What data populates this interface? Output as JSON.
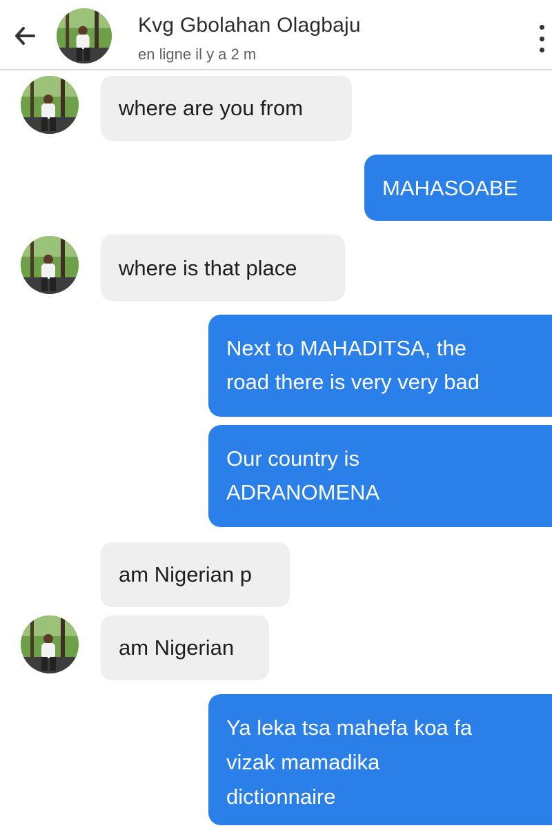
{
  "header": {
    "contact_name": "Kvg Gbolahan Olagbaju",
    "status": "en ligne il y a 2 m"
  },
  "messages": [
    {
      "direction": "incoming",
      "lines": [
        "where are you from"
      ]
    },
    {
      "direction": "outgoing",
      "lines": [
        "MAHASOABE"
      ]
    },
    {
      "direction": "incoming",
      "lines": [
        "where is that place"
      ]
    },
    {
      "direction": "outgoing",
      "lines": [
        "Next to MAHADITSA, the",
        "road there is very very bad"
      ]
    },
    {
      "direction": "outgoing",
      "lines": [
        "Our country is",
        "ADRANOMENA"
      ]
    },
    {
      "direction": "incoming",
      "lines": [
        "am Nigerian p"
      ]
    },
    {
      "direction": "incoming",
      "lines": [
        "am Nigerian"
      ]
    },
    {
      "direction": "outgoing",
      "lines": [
        "Ya leka tsa mahefa koa fa",
        "vizak mamadika",
        "dictionnaire"
      ]
    }
  ],
  "icons": {
    "back": "arrow-left-icon",
    "menu": "more-vertical-icon",
    "avatar": "contact-avatar"
  },
  "colors": {
    "incoming_bubble": "#efefef",
    "outgoing_bubble": "#2a7fe8",
    "outgoing_text": "#ffffff",
    "incoming_text": "#1e1e1e"
  }
}
